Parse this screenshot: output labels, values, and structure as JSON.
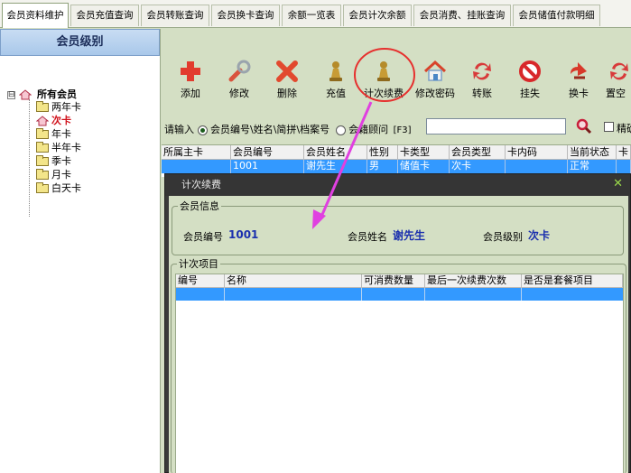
{
  "tabs": [
    {
      "label": "会员资料维护",
      "active": true
    },
    {
      "label": "会员充值查询",
      "active": false
    },
    {
      "label": "会员转账查询",
      "active": false
    },
    {
      "label": "会员换卡查询",
      "active": false
    },
    {
      "label": "余额一览表",
      "active": false
    },
    {
      "label": "会员计次余额",
      "active": false
    },
    {
      "label": "会员消费、挂账查询",
      "active": false
    },
    {
      "label": "会员储值付款明细",
      "active": false
    }
  ],
  "left_panel": {
    "title": "会员级别",
    "tree": {
      "expander": "⊟",
      "root_label": "所有会员",
      "items": [
        {
          "label": "两年卡",
          "selected": false
        },
        {
          "label": "次卡",
          "selected": true
        },
        {
          "label": "年卡",
          "selected": false
        },
        {
          "label": "半年卡",
          "selected": false
        },
        {
          "label": "季卡",
          "selected": false
        },
        {
          "label": "月卡",
          "selected": false
        },
        {
          "label": "白天卡",
          "selected": false
        }
      ]
    }
  },
  "toolbar": {
    "buttons": [
      {
        "label": "添加",
        "icon": "plus-icon"
      },
      {
        "label": "修改",
        "icon": "wrench-icon"
      },
      {
        "label": "删除",
        "icon": "x-delete-icon"
      },
      {
        "label": "充值",
        "icon": "pawn-icon"
      },
      {
        "label": "计次续费",
        "icon": "pawn-icon"
      },
      {
        "label": "修改密码",
        "icon": "house-icon"
      },
      {
        "label": "转账",
        "icon": "swap-icon"
      },
      {
        "label": "挂失",
        "icon": "no-entry-icon"
      },
      {
        "label": "换卡",
        "icon": "arrow-icon"
      },
      {
        "label": "置空",
        "icon": "refresh-icon"
      }
    ]
  },
  "search": {
    "prompt": "请输入",
    "option1": "会员编号\\姓名\\简拼\\档案号",
    "option2": "会籍顾问",
    "hotkey": "[F3]",
    "value": "",
    "exact_label": "精确"
  },
  "member_grid": {
    "columns": [
      "所属主卡",
      "会员编号",
      "会员姓名",
      "性别",
      "卡类型",
      "会员类型",
      "卡内码",
      "当前状态",
      "卡"
    ],
    "rows": [
      [
        "",
        "1001",
        "谢先生",
        "男",
        "储值卡",
        "次卡",
        "",
        "正常",
        ""
      ]
    ]
  },
  "dialog": {
    "title": "计次续费",
    "close_glyph": "✕",
    "member_info": {
      "legend": "会员信息",
      "id_label": "会员编号",
      "id_value": "1001",
      "name_label": "会员姓名",
      "name_value": "谢先生",
      "level_label": "会员级别",
      "level_value": "次卡"
    },
    "items": {
      "legend": "计次项目",
      "columns": [
        "编号",
        "名称",
        "可消费数量",
        "最后一次续费次数",
        "是否是套餐项目"
      ]
    }
  },
  "colors": {
    "annotation": "#e6302e",
    "arrow": "#e040e0",
    "selection": "#3399ff",
    "dialog_title_bg": "#353535"
  }
}
